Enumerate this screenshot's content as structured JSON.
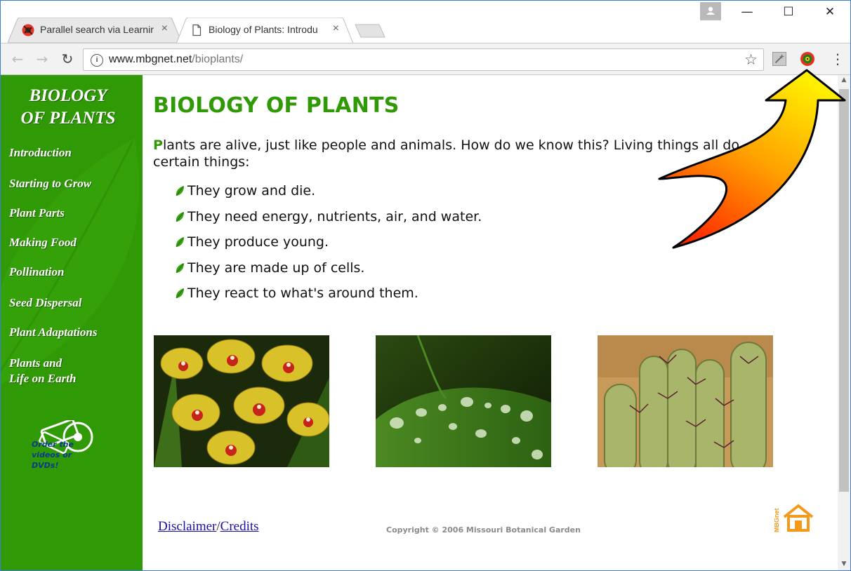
{
  "browser": {
    "tabs": [
      {
        "title": "Parallel search via Learnir",
        "close": "×",
        "active": false,
        "icon": "ladybug-icon"
      },
      {
        "title": "Biology of Plants: Introdu",
        "close": "×",
        "active": true,
        "icon": "page-icon"
      }
    ],
    "window_controls": {
      "minimize": "—",
      "maximize": "☐",
      "close": "✕"
    },
    "toolbar": {
      "back": "←",
      "forward": "→",
      "reload": "↻",
      "url_host": "www.mbgnet.net",
      "url_path": "/bioplants/",
      "info": "i",
      "bookmark": "☆",
      "menu": "⋮"
    }
  },
  "sidebar": {
    "title_line1": "BIOLOGY",
    "title_line2": "OF PLANTS",
    "nav": [
      "Introduction",
      "Starting to Grow",
      "Plant Parts",
      "Making Food",
      "Pollination",
      "Seed Dispersal",
      "Plant Adaptations",
      "Plants and",
      "Life on Earth"
    ],
    "order_text": "Order the videos or DVDs!"
  },
  "content": {
    "title": "BIOLOGY OF PLANTS",
    "intro_first_letter": "P",
    "intro_rest": "lants are alive, just like people and animals. How do we know this? Living things all do certain things:",
    "bullets": [
      "They grow and die.",
      "They need energy, nutrients, air, and water.",
      "They produce young.",
      "They are made up of cells.",
      "They react to what's around them."
    ],
    "photos": [
      "yellow-orchid-photo",
      "leaf-water-drops-photo",
      "cactus-spines-photo"
    ],
    "footer": {
      "disclaimer": "Disclaimer",
      "separator": "/",
      "credits": "Credits",
      "copyright": "Copyright © 2006 Missouri Botanical Garden",
      "home_logo_text": "MBGnet"
    }
  },
  "colors": {
    "sidebar_green": "#2f9a06",
    "title_green": "#2f9a06",
    "link_blue": "#1a0dab",
    "arrow_fill_top": "#ffef00",
    "arrow_fill_bottom": "#ff1a00"
  }
}
